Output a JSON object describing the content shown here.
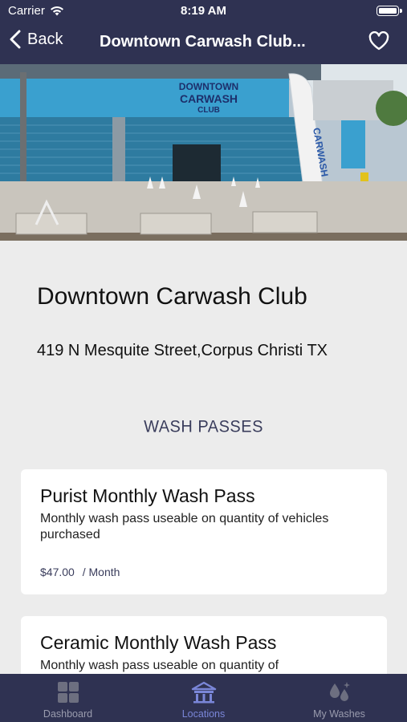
{
  "status": {
    "carrier": "Carrier",
    "time": "8:19 AM"
  },
  "nav": {
    "back_label": "Back",
    "title": "Downtown Carwash Club..."
  },
  "hero": {
    "sign_line1": "DOWNTOWN",
    "sign_line2": "CARWASH",
    "sign_line3": "CLUB",
    "flag_text": "CARWASH"
  },
  "location": {
    "name": "Downtown Carwash Club",
    "address": "419 N Mesquite Street,Corpus Christi TX"
  },
  "passes": {
    "section_title": "WASH PASSES",
    "items": [
      {
        "title": "Purist Monthly Wash Pass",
        "description": "Monthly wash pass useable on quantity of vehicles purchased",
        "price": "$47.00",
        "period": "/ Month"
      },
      {
        "title": "Ceramic Monthly Wash Pass",
        "description": "Monthly wash pass useable on quantity of"
      }
    ]
  },
  "tabs": [
    {
      "label": "Dashboard",
      "icon": "dashboard-grid-icon",
      "active": false
    },
    {
      "label": "Locations",
      "icon": "building-icon",
      "active": true
    },
    {
      "label": "My Washes",
      "icon": "water-drops-icon",
      "active": false
    }
  ],
  "colors": {
    "header": "#2f3252",
    "accent": "#7a86d8",
    "background": "#ececec"
  }
}
